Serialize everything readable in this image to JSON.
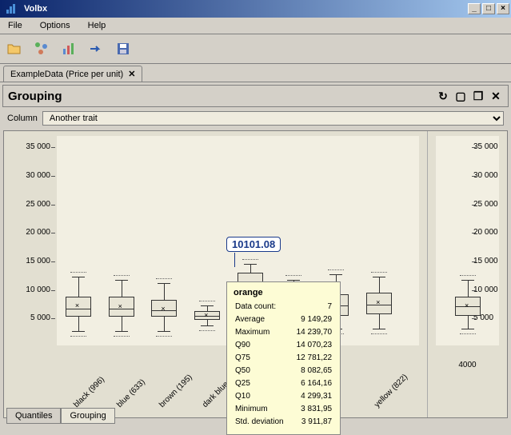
{
  "window": {
    "title": "Volbx"
  },
  "menu": {
    "file": "File",
    "options": "Options",
    "help": "Help"
  },
  "tab": {
    "label": "ExampleData (Price per unit)"
  },
  "panel": {
    "title": "Grouping"
  },
  "column": {
    "label": "Column",
    "selected": "Another trait"
  },
  "yticks": [
    "35 000",
    "30 000",
    "25 000",
    "20 000",
    "15 000",
    "10 000",
    "5 000"
  ],
  "categories": [
    {
      "label": "black (996)"
    },
    {
      "label": "blue (633)"
    },
    {
      "label": "brown (195)"
    },
    {
      "label": "dark blue (13)"
    },
    {
      "label": "orange"
    },
    {
      "label": ""
    },
    {
      "label": ""
    },
    {
      "label": "yellow (822)"
    }
  ],
  "bubble": "10101.08",
  "side_x": "4000",
  "tooltip": {
    "title": "orange",
    "rows": [
      [
        "Data count:",
        "7"
      ],
      [
        "Average",
        "9 149,29"
      ],
      [
        "Maximum",
        "14 239,70"
      ],
      [
        "Q90",
        "14 070,23"
      ],
      [
        "Q75",
        "12 781,22"
      ],
      [
        "Q50",
        "8 082,65"
      ],
      [
        "Q25",
        "6 164,16"
      ],
      [
        "Q10",
        "4 299,31"
      ],
      [
        "Minimum",
        "3 831,95"
      ],
      [
        "Std. deviation",
        "3 911,87"
      ]
    ]
  },
  "bottom_tabs": {
    "quantiles": "Quantiles",
    "grouping": "Grouping"
  },
  "chart_data": {
    "type": "boxplot",
    "ylim": [
      0,
      37000
    ],
    "categories": [
      "black (996)",
      "blue (633)",
      "brown (195)",
      "dark blue (13)",
      "orange (7)",
      "...",
      "...",
      "yellow (822)"
    ],
    "series": [
      {
        "min": 2500,
        "q25": 5000,
        "q50": 6500,
        "q75": 8500,
        "max": 12000,
        "mean": 7000
      },
      {
        "min": 2500,
        "q25": 5000,
        "q50": 6500,
        "q75": 8500,
        "max": 11500,
        "mean": 6800
      },
      {
        "min": 2500,
        "q25": 5000,
        "q50": 6200,
        "q75": 8000,
        "max": 11000,
        "mean": 6500
      },
      {
        "min": 3500,
        "q25": 4500,
        "q50": 5200,
        "q75": 6000,
        "max": 7000,
        "mean": 5300
      },
      {
        "min": 3832,
        "q25": 6164,
        "q50": 8083,
        "q75": 12781,
        "max": 14240,
        "mean": 9149
      },
      {
        "min": 3000,
        "q25": 5000,
        "q50": 6800,
        "q75": 8500,
        "max": 11500,
        "mean": 7000
      },
      {
        "min": 3000,
        "q25": 5200,
        "q50": 7000,
        "q75": 9000,
        "max": 12500,
        "mean": 7500
      },
      {
        "min": 3000,
        "q25": 5500,
        "q50": 7200,
        "q75": 9200,
        "max": 12000,
        "mean": 7600
      }
    ],
    "summary_box": {
      "min": 3000,
      "q25": 5200,
      "q50": 6800,
      "q75": 8500,
      "max": 11500,
      "mean": 7000
    }
  }
}
